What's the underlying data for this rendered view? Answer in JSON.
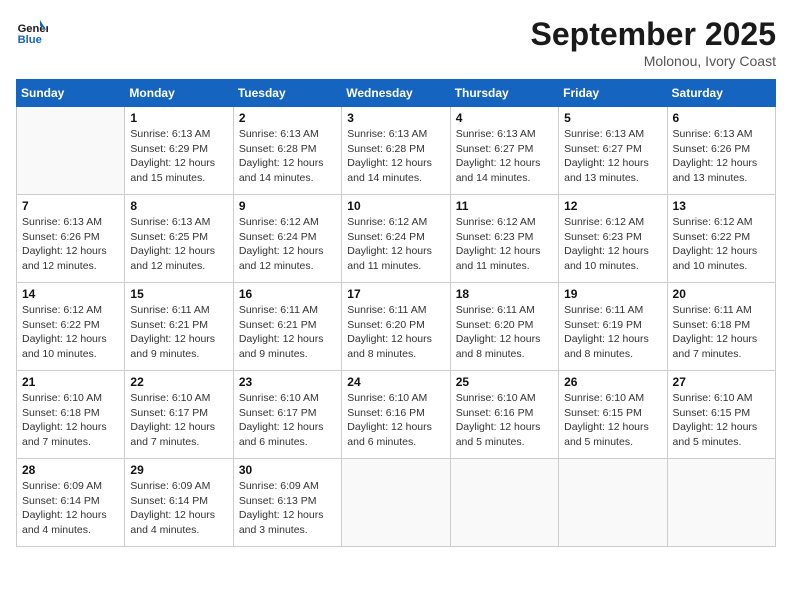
{
  "header": {
    "logo_line1": "General",
    "logo_line2": "Blue",
    "month": "September 2025",
    "location": "Molonou, Ivory Coast"
  },
  "weekdays": [
    "Sunday",
    "Monday",
    "Tuesday",
    "Wednesday",
    "Thursday",
    "Friday",
    "Saturday"
  ],
  "weeks": [
    [
      {
        "day": "",
        "info": ""
      },
      {
        "day": "1",
        "info": "Sunrise: 6:13 AM\nSunset: 6:29 PM\nDaylight: 12 hours\nand 15 minutes."
      },
      {
        "day": "2",
        "info": "Sunrise: 6:13 AM\nSunset: 6:28 PM\nDaylight: 12 hours\nand 14 minutes."
      },
      {
        "day": "3",
        "info": "Sunrise: 6:13 AM\nSunset: 6:28 PM\nDaylight: 12 hours\nand 14 minutes."
      },
      {
        "day": "4",
        "info": "Sunrise: 6:13 AM\nSunset: 6:27 PM\nDaylight: 12 hours\nand 14 minutes."
      },
      {
        "day": "5",
        "info": "Sunrise: 6:13 AM\nSunset: 6:27 PM\nDaylight: 12 hours\nand 13 minutes."
      },
      {
        "day": "6",
        "info": "Sunrise: 6:13 AM\nSunset: 6:26 PM\nDaylight: 12 hours\nand 13 minutes."
      }
    ],
    [
      {
        "day": "7",
        "info": "Sunrise: 6:13 AM\nSunset: 6:26 PM\nDaylight: 12 hours\nand 12 minutes."
      },
      {
        "day": "8",
        "info": "Sunrise: 6:13 AM\nSunset: 6:25 PM\nDaylight: 12 hours\nand 12 minutes."
      },
      {
        "day": "9",
        "info": "Sunrise: 6:12 AM\nSunset: 6:24 PM\nDaylight: 12 hours\nand 12 minutes."
      },
      {
        "day": "10",
        "info": "Sunrise: 6:12 AM\nSunset: 6:24 PM\nDaylight: 12 hours\nand 11 minutes."
      },
      {
        "day": "11",
        "info": "Sunrise: 6:12 AM\nSunset: 6:23 PM\nDaylight: 12 hours\nand 11 minutes."
      },
      {
        "day": "12",
        "info": "Sunrise: 6:12 AM\nSunset: 6:23 PM\nDaylight: 12 hours\nand 10 minutes."
      },
      {
        "day": "13",
        "info": "Sunrise: 6:12 AM\nSunset: 6:22 PM\nDaylight: 12 hours\nand 10 minutes."
      }
    ],
    [
      {
        "day": "14",
        "info": "Sunrise: 6:12 AM\nSunset: 6:22 PM\nDaylight: 12 hours\nand 10 minutes."
      },
      {
        "day": "15",
        "info": "Sunrise: 6:11 AM\nSunset: 6:21 PM\nDaylight: 12 hours\nand 9 minutes."
      },
      {
        "day": "16",
        "info": "Sunrise: 6:11 AM\nSunset: 6:21 PM\nDaylight: 12 hours\nand 9 minutes."
      },
      {
        "day": "17",
        "info": "Sunrise: 6:11 AM\nSunset: 6:20 PM\nDaylight: 12 hours\nand 8 minutes."
      },
      {
        "day": "18",
        "info": "Sunrise: 6:11 AM\nSunset: 6:20 PM\nDaylight: 12 hours\nand 8 minutes."
      },
      {
        "day": "19",
        "info": "Sunrise: 6:11 AM\nSunset: 6:19 PM\nDaylight: 12 hours\nand 8 minutes."
      },
      {
        "day": "20",
        "info": "Sunrise: 6:11 AM\nSunset: 6:18 PM\nDaylight: 12 hours\nand 7 minutes."
      }
    ],
    [
      {
        "day": "21",
        "info": "Sunrise: 6:10 AM\nSunset: 6:18 PM\nDaylight: 12 hours\nand 7 minutes."
      },
      {
        "day": "22",
        "info": "Sunrise: 6:10 AM\nSunset: 6:17 PM\nDaylight: 12 hours\nand 7 minutes."
      },
      {
        "day": "23",
        "info": "Sunrise: 6:10 AM\nSunset: 6:17 PM\nDaylight: 12 hours\nand 6 minutes."
      },
      {
        "day": "24",
        "info": "Sunrise: 6:10 AM\nSunset: 6:16 PM\nDaylight: 12 hours\nand 6 minutes."
      },
      {
        "day": "25",
        "info": "Sunrise: 6:10 AM\nSunset: 6:16 PM\nDaylight: 12 hours\nand 5 minutes."
      },
      {
        "day": "26",
        "info": "Sunrise: 6:10 AM\nSunset: 6:15 PM\nDaylight: 12 hours\nand 5 minutes."
      },
      {
        "day": "27",
        "info": "Sunrise: 6:10 AM\nSunset: 6:15 PM\nDaylight: 12 hours\nand 5 minutes."
      }
    ],
    [
      {
        "day": "28",
        "info": "Sunrise: 6:09 AM\nSunset: 6:14 PM\nDaylight: 12 hours\nand 4 minutes."
      },
      {
        "day": "29",
        "info": "Sunrise: 6:09 AM\nSunset: 6:14 PM\nDaylight: 12 hours\nand 4 minutes."
      },
      {
        "day": "30",
        "info": "Sunrise: 6:09 AM\nSunset: 6:13 PM\nDaylight: 12 hours\nand 3 minutes."
      },
      {
        "day": "",
        "info": ""
      },
      {
        "day": "",
        "info": ""
      },
      {
        "day": "",
        "info": ""
      },
      {
        "day": "",
        "info": ""
      }
    ]
  ]
}
